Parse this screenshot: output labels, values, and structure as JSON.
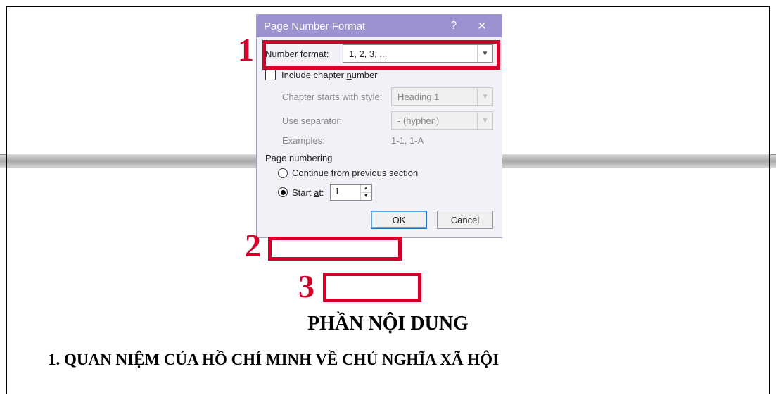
{
  "dialog": {
    "title": "Page Number Format",
    "help": "?",
    "close": "✕",
    "number_format_label_pre": "Number ",
    "number_format_label_u": "f",
    "number_format_label_post": "ormat:",
    "number_format_value": "1, 2, 3, ...",
    "include_chapter_pre": "Include chapter ",
    "include_chapter_u": "n",
    "include_chapter_post": "umber",
    "chapter_starts_label": "Chapter starts with style:",
    "chapter_starts_value": "Heading 1",
    "separator_label": "Use separator:",
    "separator_value": "-   (hyphen)",
    "examples_label": "Examples:",
    "examples_value": "1-1, 1-A",
    "section_label": "Page numbering",
    "continue_label_u": "C",
    "continue_label_post": "ontinue from previous section",
    "start_at_pre": "Start ",
    "start_at_u": "a",
    "start_at_post": "t:",
    "start_at_value": "1",
    "ok": "OK",
    "cancel": "Cancel"
  },
  "callouts": {
    "one": "1",
    "two": "2",
    "three": "3"
  },
  "document": {
    "title": "PHẦN NỘI DUNG",
    "heading": "1.  QUAN NIỆM CỦA HỒ CHÍ MINH VỀ CHỦ NGHĨA XÃ HỘI"
  }
}
